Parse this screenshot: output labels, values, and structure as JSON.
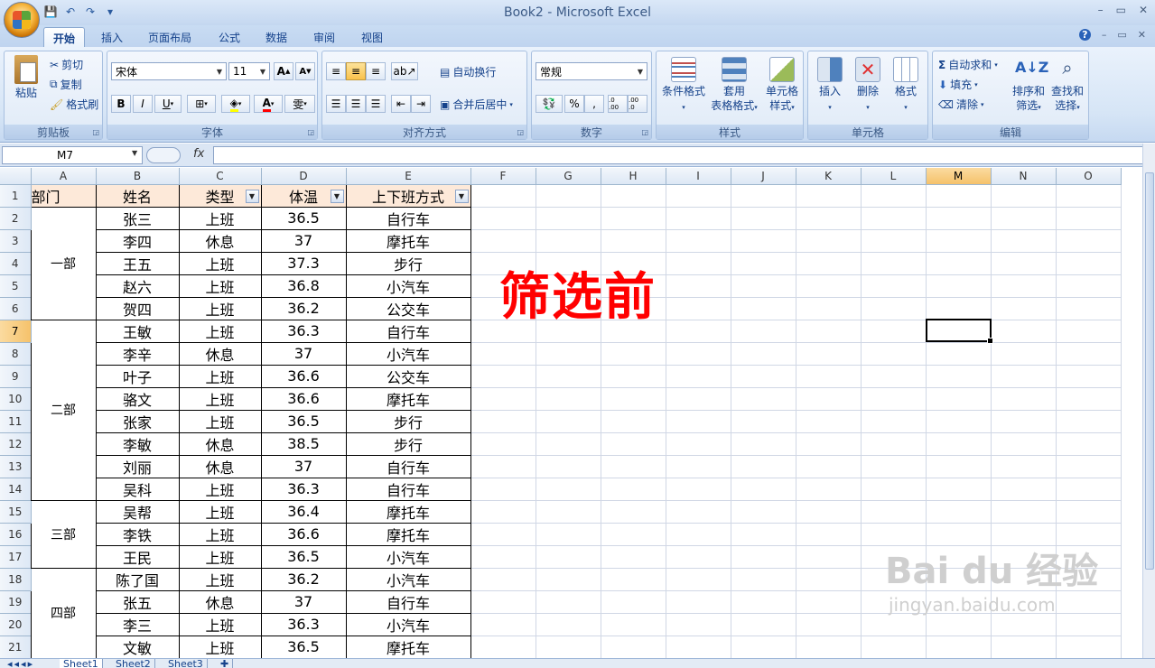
{
  "window": {
    "title": "Book2 - Microsoft Excel",
    "minimize": "–",
    "restore": "▭",
    "close": "✕"
  },
  "doc_controls": {
    "help": "?",
    "minimize": "–",
    "restore": "▭",
    "close": "✕"
  },
  "qat": {
    "save": "💾",
    "undo": "↶",
    "redo": "↷",
    "customize": "▾"
  },
  "tabs": [
    "开始",
    "插入",
    "页面布局",
    "公式",
    "数据",
    "审阅",
    "视图"
  ],
  "ribbon": {
    "clipboard": {
      "label": "剪贴板",
      "paste": "粘贴",
      "cut": "剪切",
      "copy": "复制",
      "format_painter": "格式刷"
    },
    "font": {
      "label": "字体",
      "font_name": "宋体",
      "font_size": "11",
      "grow": "A",
      "shrink": "A",
      "bold": "B",
      "italic": "I",
      "underline": "U",
      "border": "⊞",
      "fill": "◈",
      "color": "A",
      "phonetic": "雯"
    },
    "alignment": {
      "label": "对齐方式",
      "wrap": "自动换行",
      "merge": "合并后居中"
    },
    "number": {
      "label": "数字",
      "format": "常规",
      "percent": "%",
      "comma": ",",
      "inc": ".0 .00",
      "dec": ".00 .0"
    },
    "styles": {
      "label": "样式",
      "conditional": "条件格式",
      "table_line1": "套用",
      "table_line2": "表格格式",
      "cell_line1": "单元格",
      "cell_line2": "样式"
    },
    "cells": {
      "label": "单元格",
      "insert": "插入",
      "delete": "删除",
      "format": "格式"
    },
    "editing": {
      "label": "编辑",
      "autosum": "自动求和",
      "fill": "填充",
      "clear": "清除",
      "sort_line1": "排序和",
      "sort_line2": "筛选",
      "find_line1": "查找和",
      "find_line2": "选择"
    }
  },
  "formula_bar": {
    "name_box": "M7",
    "fx": "fx",
    "value": ""
  },
  "columns": [
    "A",
    "B",
    "C",
    "D",
    "E",
    "F",
    "G",
    "H",
    "I",
    "J",
    "K",
    "L",
    "M",
    "N",
    "O"
  ],
  "selected_column": "M",
  "selected_row": 7,
  "header": {
    "dept": "部门",
    "name": "姓名",
    "type": "类型",
    "temp": "体温",
    "commute": "上下班方式"
  },
  "departments": [
    {
      "name": "一部",
      "rows": 5
    },
    {
      "name": "二部",
      "rows": 8
    },
    {
      "name": "三部",
      "rows": 3
    },
    {
      "name": "四部",
      "rows": 4
    }
  ],
  "records": [
    [
      "张三",
      "上班",
      "36.5",
      "自行车"
    ],
    [
      "李四",
      "休息",
      "37",
      "摩托车"
    ],
    [
      "王五",
      "上班",
      "37.3",
      "步行"
    ],
    [
      "赵六",
      "上班",
      "36.8",
      "小汽车"
    ],
    [
      "贺四",
      "上班",
      "36.2",
      "公交车"
    ],
    [
      "王敏",
      "上班",
      "36.3",
      "自行车"
    ],
    [
      "李辛",
      "休息",
      "37",
      "小汽车"
    ],
    [
      "叶子",
      "上班",
      "36.6",
      "公交车"
    ],
    [
      "骆文",
      "上班",
      "36.6",
      "摩托车"
    ],
    [
      "张家",
      "上班",
      "36.5",
      "步行"
    ],
    [
      "李敏",
      "休息",
      "38.5",
      "步行"
    ],
    [
      "刘丽",
      "休息",
      "37",
      "自行车"
    ],
    [
      "吴科",
      "上班",
      "36.3",
      "自行车"
    ],
    [
      "吴帮",
      "上班",
      "36.4",
      "摩托车"
    ],
    [
      "李铁",
      "上班",
      "36.6",
      "摩托车"
    ],
    [
      "王民",
      "上班",
      "36.5",
      "小汽车"
    ],
    [
      "陈了国",
      "上班",
      "36.2",
      "小汽车"
    ],
    [
      "张五",
      "休息",
      "37",
      "自行车"
    ],
    [
      "李三",
      "上班",
      "36.3",
      "小汽车"
    ],
    [
      "文敏",
      "上班",
      "36.5",
      "摩托车"
    ]
  ],
  "annotation": "筛选前",
  "sheets": [
    "Sheet1",
    "Sheet2",
    "Sheet3"
  ],
  "watermark": {
    "brand": "Bai du 经验",
    "url": "jingyan.baidu.com"
  }
}
